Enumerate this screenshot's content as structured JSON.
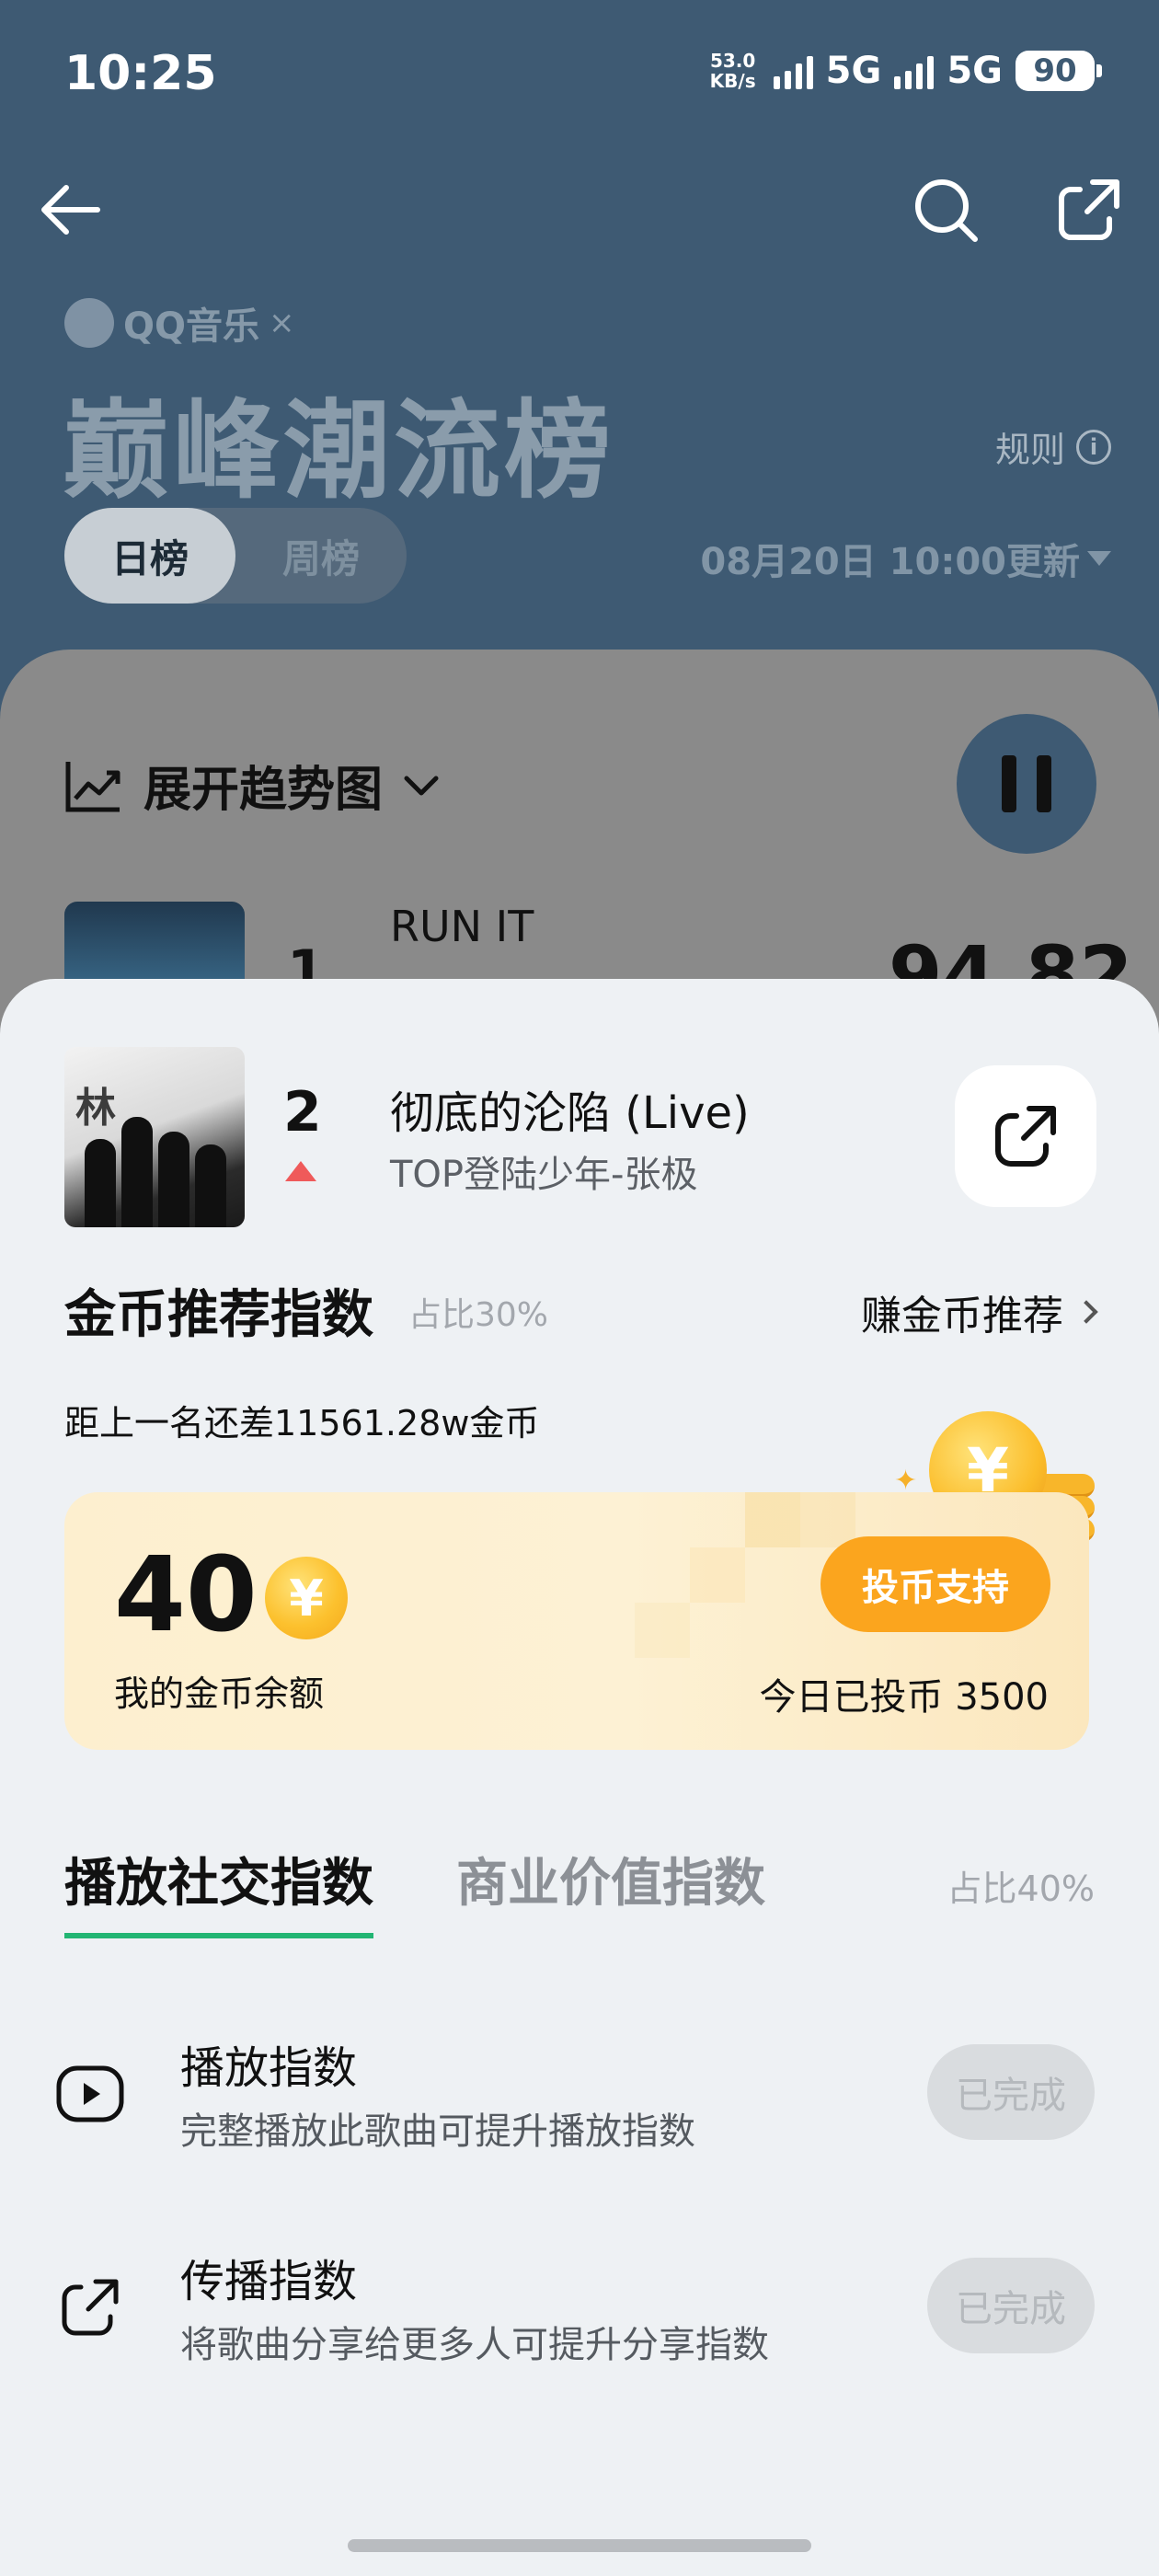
{
  "status_bar": {
    "time": "10:25",
    "net_speed_value": "53.0",
    "net_speed_unit": "KB/s",
    "sim1_label": "5G",
    "sim2_label": "5G",
    "battery": "90"
  },
  "header": {
    "brand": "QQ音乐",
    "brand_separator": "×",
    "title": "巅峰潮流榜",
    "rules_label": "规则",
    "tabs": [
      {
        "label": "日榜",
        "active": true
      },
      {
        "label": "周榜",
        "active": false
      }
    ],
    "update_time": "08月20日 10:00更新"
  },
  "list": {
    "trend_toggle_label": "展开趋势图",
    "rank1": {
      "rank": "1",
      "title": "RUN IT",
      "score": "94.82"
    }
  },
  "sheet": {
    "song": {
      "rank": "2",
      "title": "彻底的沦陷 (Live)",
      "artist": "TOP登陆少年-张极",
      "cover_text": "林"
    },
    "coin_section": {
      "title": "金币推荐指数",
      "ratio": "占比30%",
      "earn_link": "赚金币推荐",
      "gap_text": "距上一名还差11561.28w金币",
      "balance": "40",
      "balance_label": "我的金币余额",
      "vote_button": "投币支持",
      "today_voted": "今日已投币 3500",
      "coin_symbol": "¥"
    },
    "index_tabs": [
      {
        "label": "播放社交指数",
        "active": true
      },
      {
        "label": "商业价值指数",
        "active": false
      }
    ],
    "index_ratio": "占比40%",
    "tasks": [
      {
        "title": "播放指数",
        "desc": "完整播放此歌曲可提升播放指数",
        "button": "已完成",
        "icon": "play-icon"
      },
      {
        "title": "传播指数",
        "desc": "将歌曲分享给更多人可提升分享指数",
        "button": "已完成",
        "icon": "share-icon"
      }
    ]
  },
  "colors": {
    "header_bg": "#3e5a73",
    "accent_green": "#22b573",
    "vote_orange": "#fba51e",
    "rank_up_red": "#ef5a5a"
  }
}
